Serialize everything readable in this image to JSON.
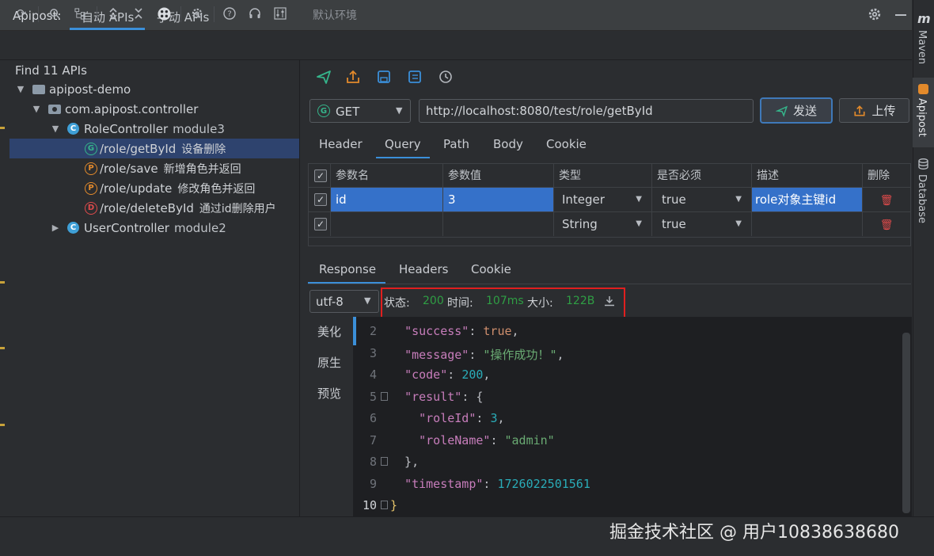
{
  "titlebar": {
    "brand": "Apipost:",
    "tab_auto": "自动 APIs",
    "tab_manual": "手动 APIs"
  },
  "toolbar": {
    "env": "默认环境"
  },
  "tree": {
    "find": "Find 11 APIs",
    "project": "apipost-demo",
    "package": "com.apipost.controller",
    "role_controller": "RoleController",
    "role_module": "module3",
    "apis": [
      {
        "method_letter": "G",
        "path": "/role/getById",
        "desc": "设备删除"
      },
      {
        "method_letter": "P",
        "path": "/role/save",
        "desc": "新增角色并返回"
      },
      {
        "method_letter": "P",
        "path": "/role/update",
        "desc": "修改角色并返回"
      },
      {
        "method_letter": "D",
        "path": "/role/deleteById",
        "desc": "通过id删除用户"
      }
    ],
    "user_controller": "UserController",
    "user_module": "module2",
    "class_letter": "C"
  },
  "request": {
    "method": "GET",
    "method_letter": "G",
    "url": "http://localhost:8080/test/role/getById",
    "send_label": "发送",
    "upload_label": "上传",
    "tabs": [
      "Header",
      "Query",
      "Path",
      "Body",
      "Cookie"
    ]
  },
  "params": {
    "headers": [
      "参数名",
      "参数值",
      "类型",
      "是否必须",
      "描述",
      "删除"
    ],
    "rows": [
      {
        "name": "id",
        "value": "3",
        "type": "Integer",
        "required": "true",
        "desc": "role对象主键id"
      },
      {
        "name": "",
        "value": "",
        "type": "String",
        "required": "true",
        "desc": ""
      }
    ]
  },
  "response": {
    "tabs": [
      "Response",
      "Headers",
      "Cookie"
    ],
    "encoding": "utf-8",
    "status_label": "状态:",
    "status_value": "200",
    "time_label": "时间:",
    "time_value": "107ms",
    "size_label": "大小:",
    "size_value": "122B",
    "side_tabs": [
      "美化",
      "原生",
      "预览"
    ],
    "line_numbers": [
      "2",
      "3",
      "4",
      "5",
      "6",
      "7",
      "8",
      "9",
      "10"
    ]
  },
  "code": {
    "success_key": "\"success\"",
    "success_val": "true",
    "message_key": "\"message\"",
    "message_val": "\"操作成功！\"",
    "code_key": "\"code\"",
    "code_val": "200",
    "result_key": "\"result\"",
    "roleId_key": "\"roleId\"",
    "roleId_val": "3",
    "roleName_key": "\"roleName\"",
    "roleName_val": "\"admin\"",
    "timestamp_key": "\"timestamp\"",
    "timestamp_val": "1726022501561"
  },
  "rail": {
    "maven": "Maven",
    "apipost": "Apipost",
    "database": "Database"
  },
  "watermark": "掘金技术社区 @ 用户1083863868​0"
}
